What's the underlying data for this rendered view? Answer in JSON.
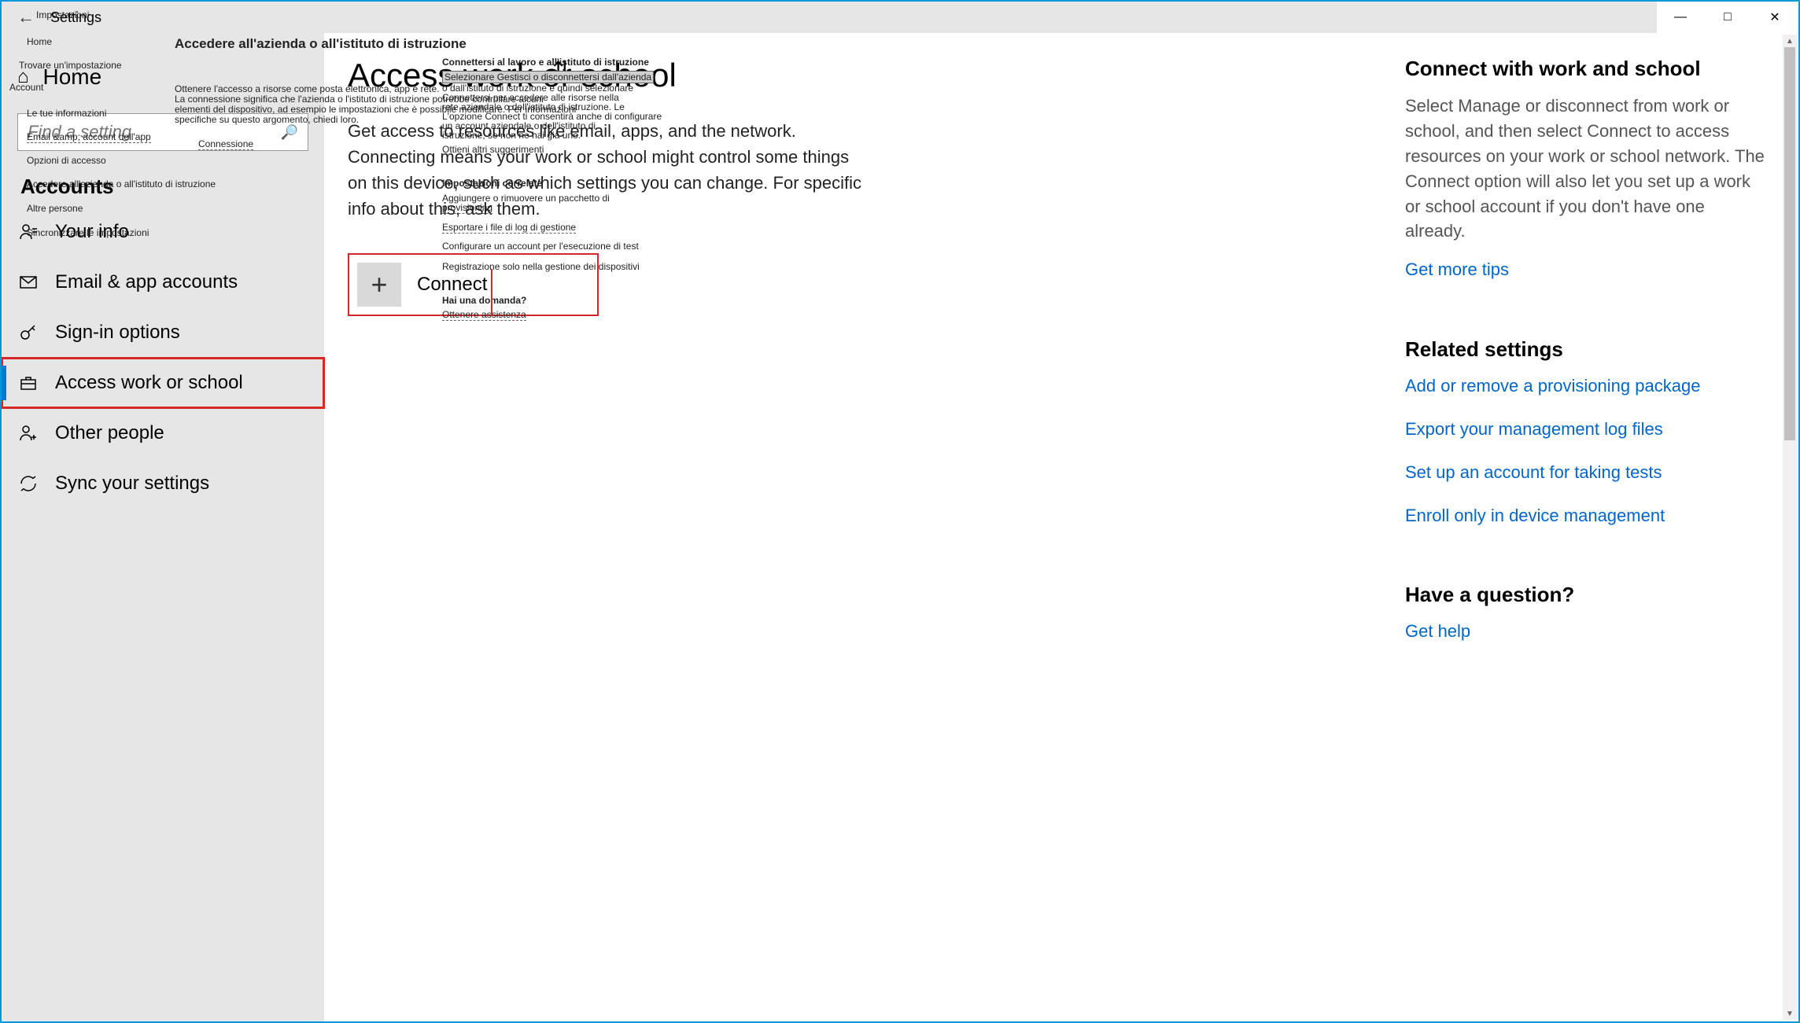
{
  "window": {
    "title": "Settings"
  },
  "sidebar": {
    "home_label": "Home",
    "search_placeholder": "Find a setting",
    "section_label": "Accounts",
    "items": [
      {
        "label": "Your info"
      },
      {
        "label": "Email & app accounts"
      },
      {
        "label": "Sign-in options"
      },
      {
        "label": "Access work or school"
      },
      {
        "label": "Other people"
      },
      {
        "label": "Sync your settings"
      }
    ]
  },
  "main": {
    "title": "Access work or school",
    "description": "Get access to resources like email, apps, and the network. Connecting means your work or school might control some things on this device, such as which settings you can change. For specific info about this, ask them.",
    "connect_label": "Connect"
  },
  "right": {
    "connect_heading": "Connect with work and school",
    "connect_text": "Select Manage or disconnect from work or school, and then select Connect to access resources on your work or school network. The Connect option will also let you set up a work or school account if you don't have one already.",
    "tips_link": "Get more tips",
    "related_heading": "Related settings",
    "related_links": [
      "Add or remove a provisioning package",
      "Export your management log files",
      "Set up an account for taking tests",
      "Enroll only in device management"
    ],
    "question_heading": "Have a question?",
    "help_link": "Get help"
  },
  "ghost": {
    "impostazioni": "Impostazioni",
    "home": "Home",
    "account": "Account",
    "trovare": "Trovare un'impostazione",
    "tue_info": "Le tue informazioni",
    "email_app": "Email &amp; account dell'app",
    "opzioni": "Opzioni di accesso",
    "accedere": "Accedere all'azienda o all'istituto di istruzione",
    "altre": "Altre persone",
    "sincro": "Sincronizzare le impostazioni",
    "accedere_title": "Accedere all'azienda o all'istituto di istruzione",
    "ottenere1": "Ottenere l'accesso a risorse come posta elettronica, app e rete.",
    "ottenere2": "La connessione significa che l'azienda o l'istituto di istruzione potrebbe controllare alcuni",
    "ottenere3": "elementi del dispositivo, ad esempio le impostazioni che è possibile modificare. Per informazioni",
    "ottenere4": "specifiche su questo argomento, chiedi loro.",
    "connessione": "Connessione",
    "connettersi1": "Connettersi al lavoro e all'istituto di istruzione",
    "selezionare": "Selezionare Gestisci o disconnettersi dall'azienda",
    "dall": "o dall'istituto di istruzione e quindi selezionare",
    "connettersi2": "Connettersi per accedere alle risorse nella",
    "rete": "rete aziendale o dell'istituto di istruzione. Le",
    "opzione": "L'opzione Connect ti consentirà anche di configurare",
    "account2": "un account aziendale o dell'istituto di",
    "istruzione": "istruzione, se non ne hai già uno.",
    "ottieni": "Ottieni altri suggerimenti",
    "imp_corr": "Impostazioni correlate",
    "aggiungere": "Aggiungere o rimuovere un pacchetto di",
    "provisioning": "provisioning",
    "esportare": "Esportare i file di log di gestione",
    "configurare": "Configurare un account per l'esecuzione di test",
    "registrazione": "Registrazione solo nella gestione dei dispositivi",
    "domanda": "Hai una domanda?",
    "assistenza": "Ottenere assistenza"
  }
}
